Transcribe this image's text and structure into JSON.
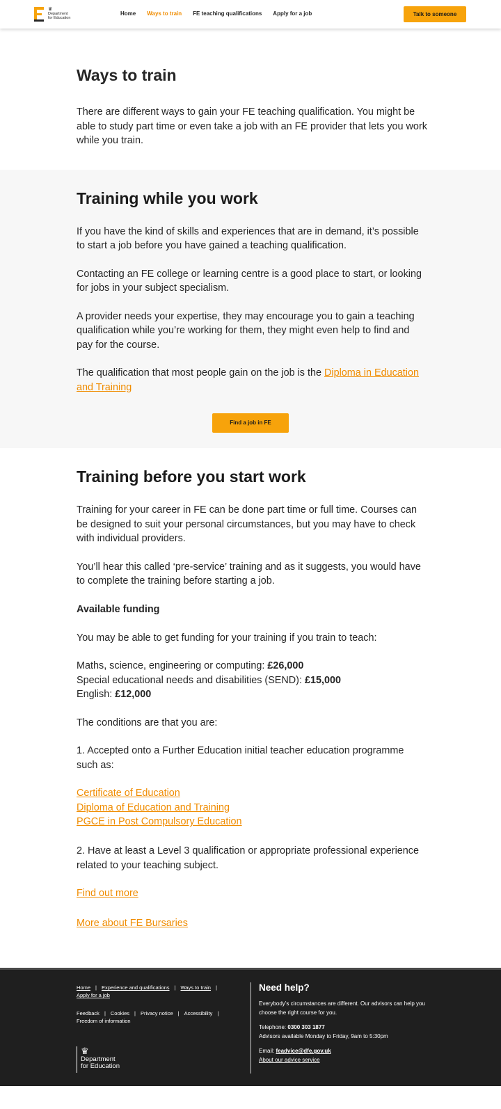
{
  "header": {
    "logo_text_line1": "Department",
    "logo_text_line2": "for Education",
    "nav": [
      {
        "label": "Home"
      },
      {
        "label": "Ways to train"
      },
      {
        "label": "FE teaching qualifications"
      },
      {
        "label": "Apply for a job"
      }
    ],
    "active_nav": "Ways to train",
    "talk_button": "Talk to someone"
  },
  "intro": {
    "title": "Ways to train",
    "text": "There are different ways to gain your FE teaching qualification. You might be able to study part time or even take a job with an FE provider that lets you work while you train."
  },
  "work_section": {
    "title": "Training while you work",
    "paragraphs": [
      "If you have the kind of skills and experiences that are in demand, it’s possible to start a job before you have gained a teaching qualification.",
      "Contacting an FE college or learning centre is a good place to start, or looking for jobs in your subject specialism.",
      "A provider needs your expertise, they may encourage you to gain a teaching qualification while you’re working for them, they might even help to find and pay for the course."
    ],
    "qualification_text": "The qualification that most people gain on the job is the ",
    "qualification_link": "Diploma in Education and Training",
    "cta": "Find a job in FE"
  },
  "before_section": {
    "title": "Training before you start work",
    "paragraphs": [
      "Training for your career in FE can be done part time or full time. Courses can be designed to suit your personal circumstances, but you may have to check with individual providers.",
      "You’ll hear this called ‘pre-service’ training and as it suggests, you would have to complete the training before starting a job."
    ],
    "funding_heading": "Available funding",
    "funding_intro": "You may be able to get funding for your training if you train to teach:",
    "funding": [
      {
        "subject": "Maths, science, engineering or computing: ",
        "amount": "£26,000"
      },
      {
        "subject": "Special educational needs and disabilities (SEND): ",
        "amount": "£15,000"
      },
      {
        "subject": "English: ",
        "amount": "£12,000"
      }
    ],
    "conditions_intro": "The conditions are that you are:",
    "condition_1": "1. Accepted onto a Further Education initial teacher education programme such as:",
    "courses": [
      "Certificate of Education",
      "Diploma of Education and Training",
      "PGCE in Post Compulsory Education"
    ],
    "condition_2": "2. Have at least a Level 3 qualification or appropriate professional experience related to your teaching subject.",
    "find_out_more": "Find out more",
    "bursaries": "More about FE Bursaries"
  },
  "footer": {
    "links_row1": [
      "Home",
      "Experience and qualifications",
      "Ways to train",
      "Apply for a job"
    ],
    "links_row2": [
      "Feedback",
      "Cookies",
      "Privacy notice",
      "Accessibility",
      "Freedom of information"
    ],
    "logo_line1": "Department",
    "logo_line2": "for Education",
    "help_title": "Need help?",
    "help_text": "Everybody’s circumstances are different. Our advisors can help you choose the right course for you.",
    "telephone_label": "Telephone: ",
    "telephone": "0300 303 1877",
    "hours": "Advisors available Monday to Friday, 9am to 5:30pm",
    "email_label": "Email: ",
    "email": "feadvice@dfe.gov.uk",
    "advice_link": "About our advice service"
  }
}
